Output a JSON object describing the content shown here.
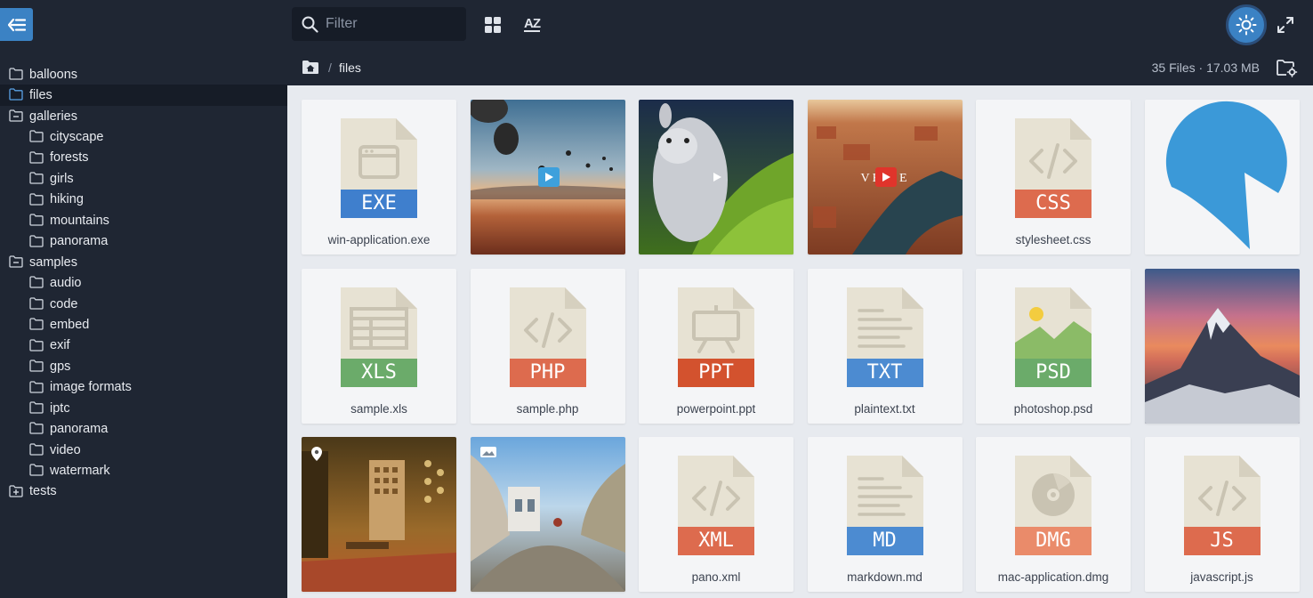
{
  "toolbar": {
    "filter_placeholder": "Filter",
    "sort_label": "AZ",
    "accent": "#3b82c4"
  },
  "sidebar": {
    "items": [
      {
        "label": "balloons",
        "level": 0,
        "icon": "folder-icon",
        "active": false
      },
      {
        "label": "files",
        "level": 0,
        "icon": "folder-icon",
        "active": true
      },
      {
        "label": "galleries",
        "level": 0,
        "icon": "folder-collapse-icon",
        "active": false
      },
      {
        "label": "cityscape",
        "level": 1,
        "icon": "folder-icon",
        "active": false
      },
      {
        "label": "forests",
        "level": 1,
        "icon": "folder-icon",
        "active": false
      },
      {
        "label": "girls",
        "level": 1,
        "icon": "folder-icon",
        "active": false
      },
      {
        "label": "hiking",
        "level": 1,
        "icon": "folder-icon",
        "active": false
      },
      {
        "label": "mountains",
        "level": 1,
        "icon": "folder-icon",
        "active": false
      },
      {
        "label": "panorama",
        "level": 1,
        "icon": "folder-icon",
        "active": false
      },
      {
        "label": "samples",
        "level": 0,
        "icon": "folder-collapse-icon",
        "active": false
      },
      {
        "label": "audio",
        "level": 1,
        "icon": "folder-icon",
        "active": false
      },
      {
        "label": "code",
        "level": 1,
        "icon": "folder-icon",
        "active": false
      },
      {
        "label": "embed",
        "level": 1,
        "icon": "folder-icon",
        "active": false
      },
      {
        "label": "exif",
        "level": 1,
        "icon": "folder-icon",
        "active": false
      },
      {
        "label": "gps",
        "level": 1,
        "icon": "folder-icon",
        "active": false
      },
      {
        "label": "image formats",
        "level": 1,
        "icon": "folder-icon",
        "active": false
      },
      {
        "label": "iptc",
        "level": 1,
        "icon": "folder-icon",
        "active": false
      },
      {
        "label": "panorama",
        "level": 1,
        "icon": "folder-icon",
        "active": false
      },
      {
        "label": "video",
        "level": 1,
        "icon": "folder-icon",
        "active": false
      },
      {
        "label": "watermark",
        "level": 1,
        "icon": "folder-icon",
        "active": false
      },
      {
        "label": "tests",
        "level": 0,
        "icon": "folder-expand-icon",
        "active": false
      }
    ]
  },
  "breadcrumb": {
    "separator": "/",
    "current": "files"
  },
  "stats": "35 Files · 17.03 MB",
  "files": [
    {
      "name": "win-application.exe",
      "kind": "doc",
      "ext": "EXE",
      "color": "#3f7fcd",
      "glyph": "window"
    },
    {
      "name": "",
      "kind": "video",
      "thumb": "balloons",
      "badge": "#3ea0dc"
    },
    {
      "name": "",
      "kind": "video",
      "thumb": "bunny",
      "badge": "none"
    },
    {
      "name": "",
      "kind": "video",
      "thumb": "venice",
      "badge": "#e0342b"
    },
    {
      "name": "stylesheet.css",
      "kind": "doc",
      "ext": "CSS",
      "color": "#dd6b4e",
      "glyph": "code"
    },
    {
      "name": "",
      "kind": "image",
      "thumb": "logo"
    },
    {
      "name": "sample.xls",
      "kind": "doc",
      "ext": "XLS",
      "color": "#6bab6a",
      "glyph": "table"
    },
    {
      "name": "sample.php",
      "kind": "doc",
      "ext": "PHP",
      "color": "#dd6b4e",
      "glyph": "code"
    },
    {
      "name": "powerpoint.ppt",
      "kind": "doc",
      "ext": "PPT",
      "color": "#d3522e",
      "glyph": "easel"
    },
    {
      "name": "plaintext.txt",
      "kind": "doc",
      "ext": "TXT",
      "color": "#4c8bd1",
      "glyph": "lines"
    },
    {
      "name": "photoshop.psd",
      "kind": "doc",
      "ext": "PSD",
      "color": "#6bab6a",
      "glyph": "picture"
    },
    {
      "name": "",
      "kind": "image",
      "thumb": "mountain"
    },
    {
      "name": "",
      "kind": "image",
      "thumb": "interior",
      "badge_icon": "map-pin-icon"
    },
    {
      "name": "",
      "kind": "image",
      "thumb": "street",
      "badge_icon": "panorama-icon"
    },
    {
      "name": "pano.xml",
      "kind": "doc",
      "ext": "XML",
      "color": "#dd6b4e",
      "glyph": "code"
    },
    {
      "name": "markdown.md",
      "kind": "doc",
      "ext": "MD",
      "color": "#4c8bd1",
      "glyph": "lines"
    },
    {
      "name": "mac-application.dmg",
      "kind": "doc",
      "ext": "DMG",
      "color": "#ea8b6a",
      "glyph": "disc"
    },
    {
      "name": "javascript.js",
      "kind": "doc",
      "ext": "JS",
      "color": "#dd6b4e",
      "glyph": "code"
    }
  ]
}
